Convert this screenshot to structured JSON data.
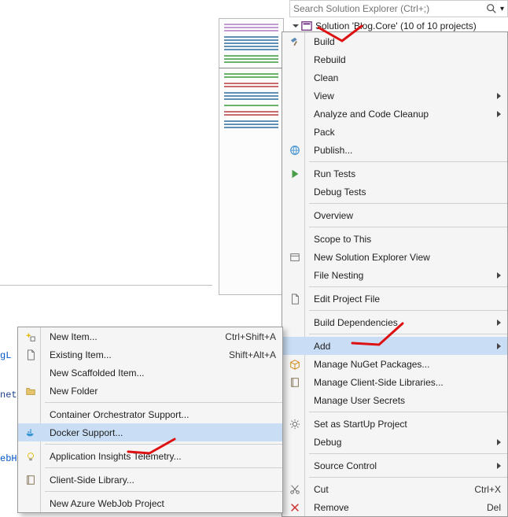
{
  "solution_explorer": {
    "search_placeholder": "Search Solution Explorer (Ctrl+;)",
    "root_label": "Solution 'Blog.Core' (10 of 10 projects)"
  },
  "context_menu": [
    {
      "id": "build",
      "label": "Build",
      "icon": "hammer"
    },
    {
      "id": "rebuild",
      "label": "Rebuild"
    },
    {
      "id": "clean",
      "label": "Clean"
    },
    {
      "id": "view",
      "label": "View",
      "arrow": true
    },
    {
      "id": "analyze",
      "label": "Analyze and Code Cleanup",
      "arrow": true
    },
    {
      "id": "pack",
      "label": "Pack"
    },
    {
      "id": "publish",
      "label": "Publish...",
      "icon": "globe"
    },
    {
      "sep": true
    },
    {
      "id": "runtests",
      "label": "Run Tests",
      "icon": "play"
    },
    {
      "id": "debugtests",
      "label": "Debug Tests"
    },
    {
      "sep": true
    },
    {
      "id": "overview",
      "label": "Overview"
    },
    {
      "sep": true
    },
    {
      "id": "scope",
      "label": "Scope to This"
    },
    {
      "id": "newview",
      "label": "New Solution Explorer View",
      "icon": "panel"
    },
    {
      "id": "filenesting",
      "label": "File Nesting",
      "arrow": true
    },
    {
      "sep": true
    },
    {
      "id": "editproj",
      "label": "Edit Project File",
      "icon": "page"
    },
    {
      "sep": true
    },
    {
      "id": "builddeps",
      "label": "Build Dependencies",
      "arrow": true
    },
    {
      "sep": true
    },
    {
      "id": "add",
      "label": "Add",
      "arrow": true,
      "highlight": true
    },
    {
      "id": "nuget",
      "label": "Manage NuGet Packages...",
      "icon": "package"
    },
    {
      "id": "clientlib",
      "label": "Manage Client-Side Libraries...",
      "icon": "booklet"
    },
    {
      "id": "secrets",
      "label": "Manage User Secrets"
    },
    {
      "sep": true
    },
    {
      "id": "startup",
      "label": "Set as StartUp Project",
      "icon": "gear"
    },
    {
      "id": "debug",
      "label": "Debug",
      "arrow": true
    },
    {
      "sep": true
    },
    {
      "id": "srcctrl",
      "label": "Source Control",
      "arrow": true
    },
    {
      "sep": true
    },
    {
      "id": "cut",
      "label": "Cut",
      "icon": "cut",
      "shortcut": "Ctrl+X"
    },
    {
      "id": "remove",
      "label": "Remove",
      "icon": "x",
      "shortcut": "Del"
    }
  ],
  "add_submenu": [
    {
      "id": "newitem",
      "label": "New Item...",
      "icon": "sparkle",
      "shortcut": "Ctrl+Shift+A"
    },
    {
      "id": "existing",
      "label": "Existing Item...",
      "icon": "page",
      "shortcut": "Shift+Alt+A"
    },
    {
      "id": "scaffold",
      "label": "New Scaffolded Item..."
    },
    {
      "id": "folder",
      "label": "New Folder",
      "icon": "folder"
    },
    {
      "sep": true
    },
    {
      "id": "orchestrator",
      "label": "Container Orchestrator Support..."
    },
    {
      "id": "docker",
      "label": "Docker Support...",
      "icon": "whale",
      "highlight": true
    },
    {
      "sep": true
    },
    {
      "id": "appinsights",
      "label": "Application Insights Telemetry...",
      "icon": "lamp"
    },
    {
      "sep": true
    },
    {
      "id": "clientlib2",
      "label": "Client-Side Library...",
      "icon": "booklet"
    },
    {
      "sep": true
    },
    {
      "id": "webjob",
      "label": "New Azure WebJob Project"
    }
  ],
  "left_fragments": {
    "gl": "gL",
    "net": "net.",
    "ebh": "ebH"
  }
}
